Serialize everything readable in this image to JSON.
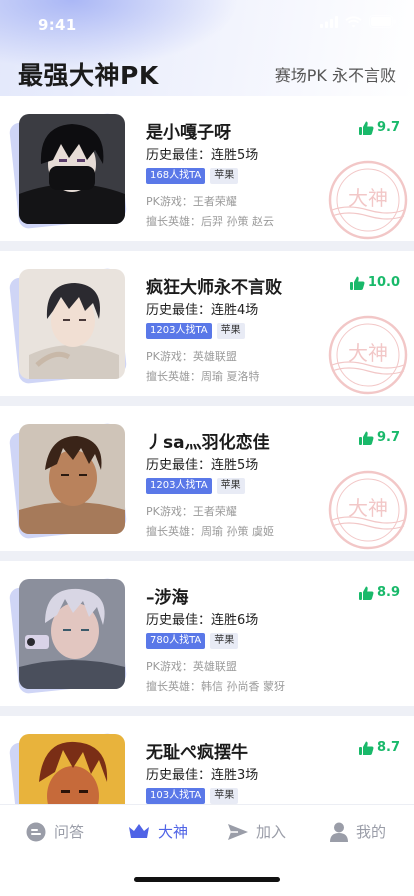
{
  "status_bar": {
    "time": "9:41"
  },
  "header": {
    "title": "最强大神PK",
    "subtitle": "赛场PK 永不言败"
  },
  "colors": {
    "accent": "#4f63e6",
    "rating_green": "#19b96a",
    "tag_blue": "#5a78e8"
  },
  "stamp_text": "大神",
  "players": [
    {
      "name": "是小嘎子呀",
      "best": "历史最佳：连胜5场",
      "seekers": "168人找TA",
      "platform": "苹果",
      "game": "PK游戏：王者荣耀",
      "heroes": "擅长英雄：后羿 孙策 赵云",
      "rating": "9.7",
      "stamp": true
    },
    {
      "name": "疯狂大师永不言败",
      "best": "历史最佳：连胜4场",
      "seekers": "1203人找TA",
      "platform": "苹果",
      "game": "PK游戏：英雄联盟",
      "heroes": "擅长英雄：周瑜 夏洛特",
      "rating": "10.0",
      "stamp": true
    },
    {
      "name": "丿sa灬羽化恋佳",
      "best": "历史最佳：连胜5场",
      "seekers": "1203人找TA",
      "platform": "苹果",
      "game": "PK游戏：王者荣耀",
      "heroes": "擅长英雄：周瑜 孙策 虞姬",
      "rating": "9.7",
      "stamp": true
    },
    {
      "name": "–涉海",
      "best": "历史最佳：连胜6场",
      "seekers": "780人找TA",
      "platform": "苹果",
      "game": "PK游戏：英雄联盟",
      "heroes": "擅长英雄：韩信 孙尚香 蒙犽",
      "rating": "8.9",
      "stamp": false
    },
    {
      "name": "无耻ぺ疯摆牛",
      "best": "历史最佳：连胜3场",
      "seekers": "103人找TA",
      "platform": "苹果",
      "game": "",
      "heroes": "",
      "rating": "8.7",
      "stamp": false
    }
  ],
  "tabs": [
    {
      "label": "问答",
      "icon": "chat-icon",
      "active": false
    },
    {
      "label": "大神",
      "icon": "crown-icon",
      "active": true
    },
    {
      "label": "加入",
      "icon": "send-icon",
      "active": false
    },
    {
      "label": "我的",
      "icon": "user-icon",
      "active": false
    }
  ]
}
